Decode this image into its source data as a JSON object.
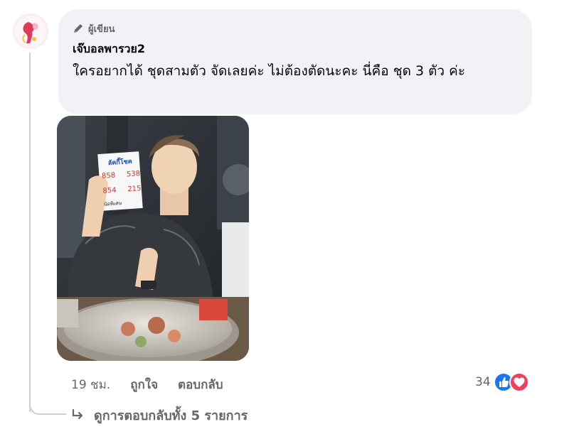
{
  "comment": {
    "author_badge_label": "ผู้เขียน",
    "author_name": "เจ๊บอลพารวย2",
    "text": "ใครอยากได้ ชุดสามตัว จัดเลยค่ะ ไม่ต้องตัดนะคะ นี่คือ ชุด 3 ตัว ค่ะ"
  },
  "photo": {
    "card_title": "ลัคกี้โชค",
    "card_numbers": [
      "858",
      "538",
      "854",
      "215"
    ],
    "card_note": "นัดพิเศษ"
  },
  "actions": {
    "timestamp": "19 ชม.",
    "like_label": "ถูกใจ",
    "reply_label": "ตอบกลับ"
  },
  "reactions": {
    "count": "34",
    "icons": [
      "like-icon",
      "love-icon"
    ],
    "colors": {
      "like": "#1877f2",
      "love": "#f33e58"
    }
  },
  "replies": {
    "label": "ดูการตอบกลับทั้ง 5 รายการ"
  }
}
